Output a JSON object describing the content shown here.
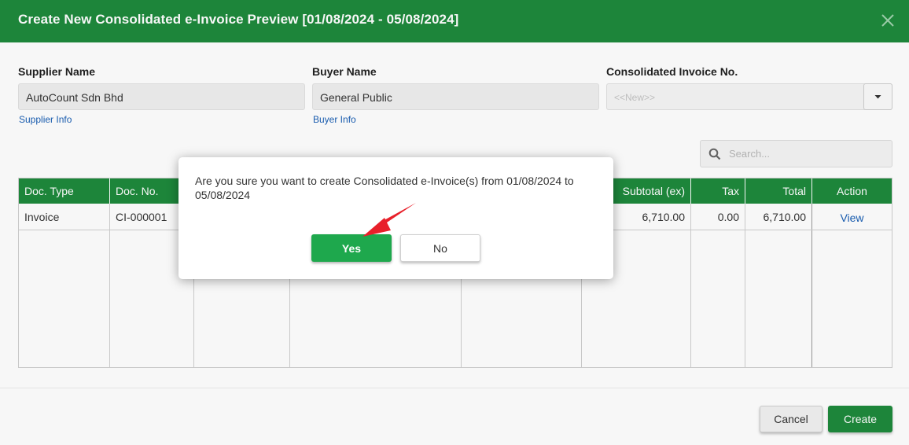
{
  "dialog": {
    "title": "Create New Consolidated e-Invoice Preview [01/08/2024 - 05/08/2024]"
  },
  "supplier": {
    "label": "Supplier Name",
    "value": "AutoCount Sdn Bhd",
    "link": "Supplier Info"
  },
  "buyer": {
    "label": "Buyer Name",
    "value": "General Public",
    "link": "Buyer Info"
  },
  "consolidated_invoice": {
    "label": "Consolidated Invoice No.",
    "placeholder": "<<New>>"
  },
  "search": {
    "placeholder": "Search..."
  },
  "table": {
    "columns": [
      "Doc. Type",
      "Doc. No.",
      "",
      "",
      "",
      "Subtotal (ex)",
      "Tax",
      "Total",
      "Action"
    ],
    "rows": [
      {
        "doc_type": "Invoice",
        "doc_no": "CI-000001",
        "subtotal": "6,710.00",
        "tax": "0.00",
        "total": "6,710.00",
        "action": "View"
      }
    ]
  },
  "footer": {
    "cancel": "Cancel",
    "create": "Create"
  },
  "confirm": {
    "message": "Are you sure you want to create Consolidated e-Invoice(s) from 01/08/2024 to 05/08/2024",
    "yes": "Yes",
    "no": "No"
  },
  "colors": {
    "header_green": "#1e8a3c",
    "yes_green": "#1ea84d",
    "link_blue": "#1a5fb4",
    "arrow_red": "#e8202a"
  }
}
